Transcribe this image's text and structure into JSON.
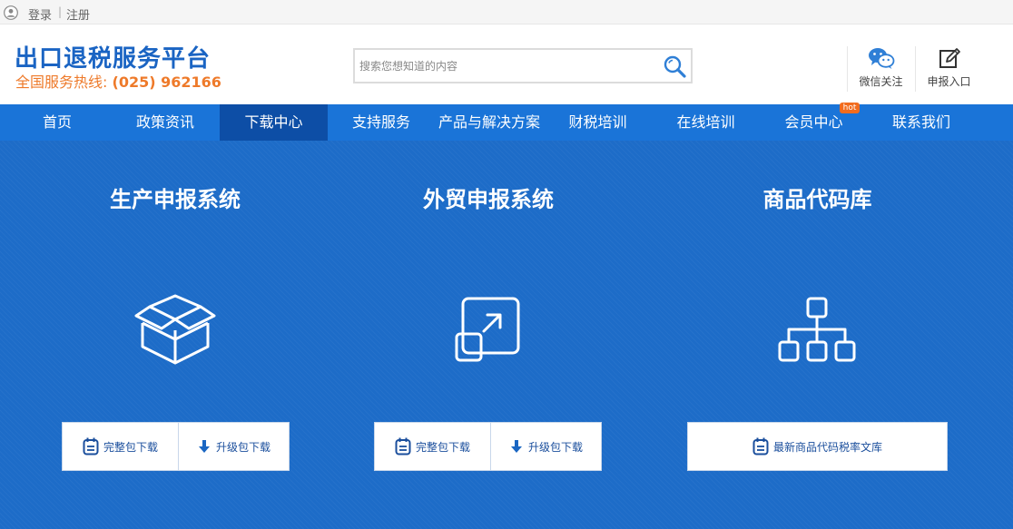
{
  "topbar": {
    "login": "登录",
    "separator": "|",
    "register": "注册"
  },
  "header": {
    "title": "出口退税服务平台",
    "hotline_label": "全国服务热线:",
    "hotline_number": "(025) 962166",
    "search_placeholder": "搜索您想知道的内容",
    "wechat_label": "微信关注",
    "declare_label": "申报入口"
  },
  "nav": {
    "items": [
      "首页",
      "政策资讯",
      "下载中心",
      "支持服务",
      "产品与解决方案",
      "财税培训",
      "在线培训",
      "会员中心",
      "联系我们"
    ],
    "active": "下载中心",
    "hot_badge": "hot"
  },
  "sections": [
    {
      "title": "生产申报系统",
      "icon": "open-box-icon",
      "buttons": [
        "完整包下载",
        "升级包下载"
      ]
    },
    {
      "title": "外贸申报系统",
      "icon": "expand-arrow-icon",
      "buttons": [
        "完整包下载",
        "升级包下载"
      ]
    },
    {
      "title": "商品代码库",
      "icon": "hierarchy-icon",
      "buttons": [
        "最新商品代码税率文库"
      ]
    }
  ],
  "colors": {
    "brand_blue": "#1a64c3",
    "nav_blue": "#1a74d8",
    "nav_active": "#0d4ea6",
    "hotline_orange": "#ee7a2a",
    "main_bg": "#1d6cc8",
    "hot_badge": "#f26c1e"
  }
}
